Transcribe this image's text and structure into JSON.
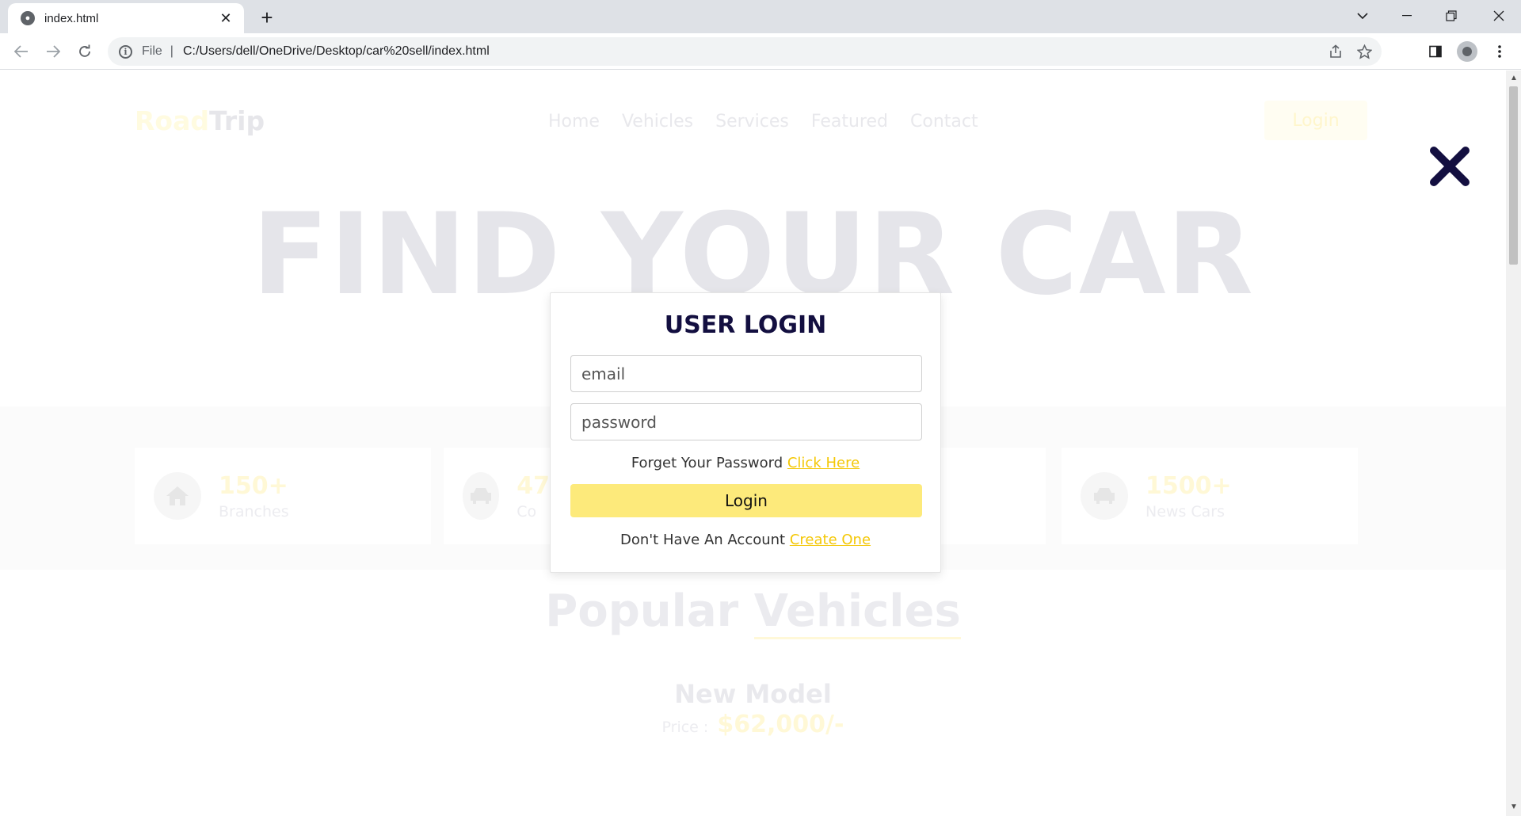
{
  "browser": {
    "tab_title": "index.html",
    "new_tab": "+",
    "tab_close": "✕",
    "file_label": "File",
    "separator": "|",
    "url": "C:/Users/dell/OneDrive/Desktop/car%20sell/index.html"
  },
  "page": {
    "logo_part1": "Road",
    "logo_part2": "Trip",
    "nav": [
      "Home",
      "Vehicles",
      "Services",
      "Featured",
      "Contact"
    ],
    "nav_login": "Login",
    "hero_title": "FIND YOUR CAR",
    "stats": [
      {
        "number": "150+",
        "label": "Branches",
        "icon": "home-icon"
      },
      {
        "number": "47",
        "label": "Co",
        "icon": "car-icon"
      },
      {
        "number": "",
        "label": "",
        "icon": "car-icon"
      },
      {
        "number": "1500+",
        "label": "News Cars",
        "icon": "car-icon"
      }
    ],
    "section_title_part1": "Popular",
    "section_title_part2": "Vehicles",
    "model_title": "New Model",
    "price_label": "Price :",
    "price_value": "$62,000/-"
  },
  "login_modal": {
    "title": "USER LOGIN",
    "email_placeholder": "email",
    "password_placeholder": "password",
    "forgot_text": "Forget Your Password",
    "forgot_link": "Click Here",
    "login_button": "Login",
    "signup_text": "Don't Have An Account",
    "signup_link": "Create One"
  },
  "colors": {
    "accent": "#fdea7b",
    "link": "#f4c808",
    "title": "#130f40"
  }
}
